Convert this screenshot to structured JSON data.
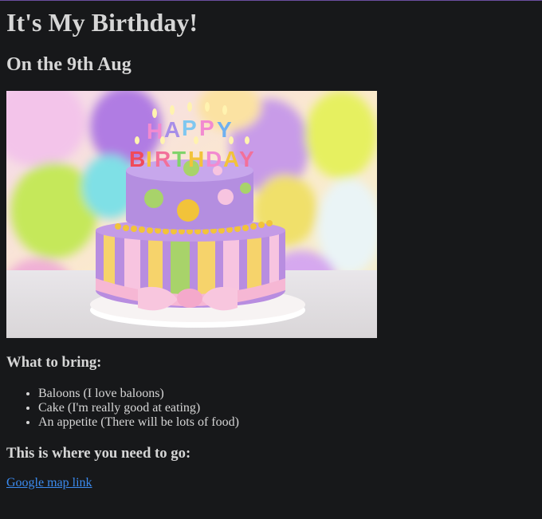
{
  "page": {
    "title": "It's My Birthday!",
    "date_heading": "On the 9th Aug",
    "hero_image": "birthday-cake-photo",
    "bring_heading": "What to bring:",
    "bring_items": [
      "Baloons (I love baloons)",
      "Cake (I'm really good at eating)",
      "An appetite (There will be lots of food)"
    ],
    "go_heading": "This is where you need to go:",
    "map_link": "Google map link"
  },
  "colors": {
    "background": "#17181a",
    "text": "#d6d6d6",
    "link": "#3b8bf0"
  }
}
